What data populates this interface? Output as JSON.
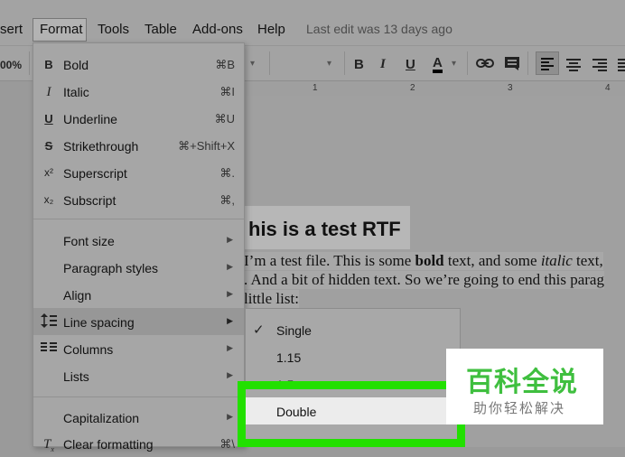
{
  "menubar": {
    "insert_partial": "sert",
    "format": "Format",
    "tools": "Tools",
    "table": "Table",
    "addons": "Add-ons",
    "help": "Help",
    "last_edit": "Last edit was 13 days ago"
  },
  "toolbar": {
    "zoom_partial": "00%",
    "bold": "B",
    "italic": "I",
    "underline": "U",
    "text_color": "A"
  },
  "ruler": {
    "marks": [
      "1",
      "2",
      "3",
      "4"
    ]
  },
  "document": {
    "title": "his is a test RTF",
    "line1_a": "I’m a test file. This is some ",
    "line1_bold": "bold",
    "line1_b": " text, and some ",
    "line1_italic": "italic",
    "line1_c": " text,",
    "line2": ". And a bit of hidden text. So we’re going to end this parag",
    "line3": " little list:"
  },
  "format_menu": {
    "bold": {
      "label": "Bold",
      "shortcut": "⌘B",
      "icon": "B"
    },
    "italic": {
      "label": "Italic",
      "shortcut": "⌘I",
      "icon": "I"
    },
    "underline": {
      "label": "Underline",
      "shortcut": "⌘U",
      "icon": "U"
    },
    "strikethrough": {
      "label": "Strikethrough",
      "shortcut": "⌘+Shift+X",
      "icon": "S"
    },
    "superscript": {
      "label": "Superscript",
      "shortcut": "⌘.",
      "icon": "x²"
    },
    "subscript": {
      "label": "Subscript",
      "shortcut": "⌘,",
      "icon": "x₂"
    },
    "font_size": {
      "label": "Font size"
    },
    "paragraph_styles": {
      "label": "Paragraph styles"
    },
    "align": {
      "label": "Align"
    },
    "line_spacing": {
      "label": "Line spacing"
    },
    "columns": {
      "label": "Columns"
    },
    "lists": {
      "label": "Lists"
    },
    "capitalization": {
      "label": "Capitalization"
    },
    "clear_formatting": {
      "label": "Clear formatting",
      "shortcut": "⌘\\"
    }
  },
  "line_spacing_submenu": {
    "single": "Single",
    "one_fifteen": "1.15",
    "one_five_partial": "1.5",
    "double": "Double"
  },
  "watermark": {
    "big": "百科全说",
    "small": "助你轻松解决"
  },
  "colors": {
    "highlight": "#22e000",
    "watermark_green": "#3fbf3f"
  }
}
